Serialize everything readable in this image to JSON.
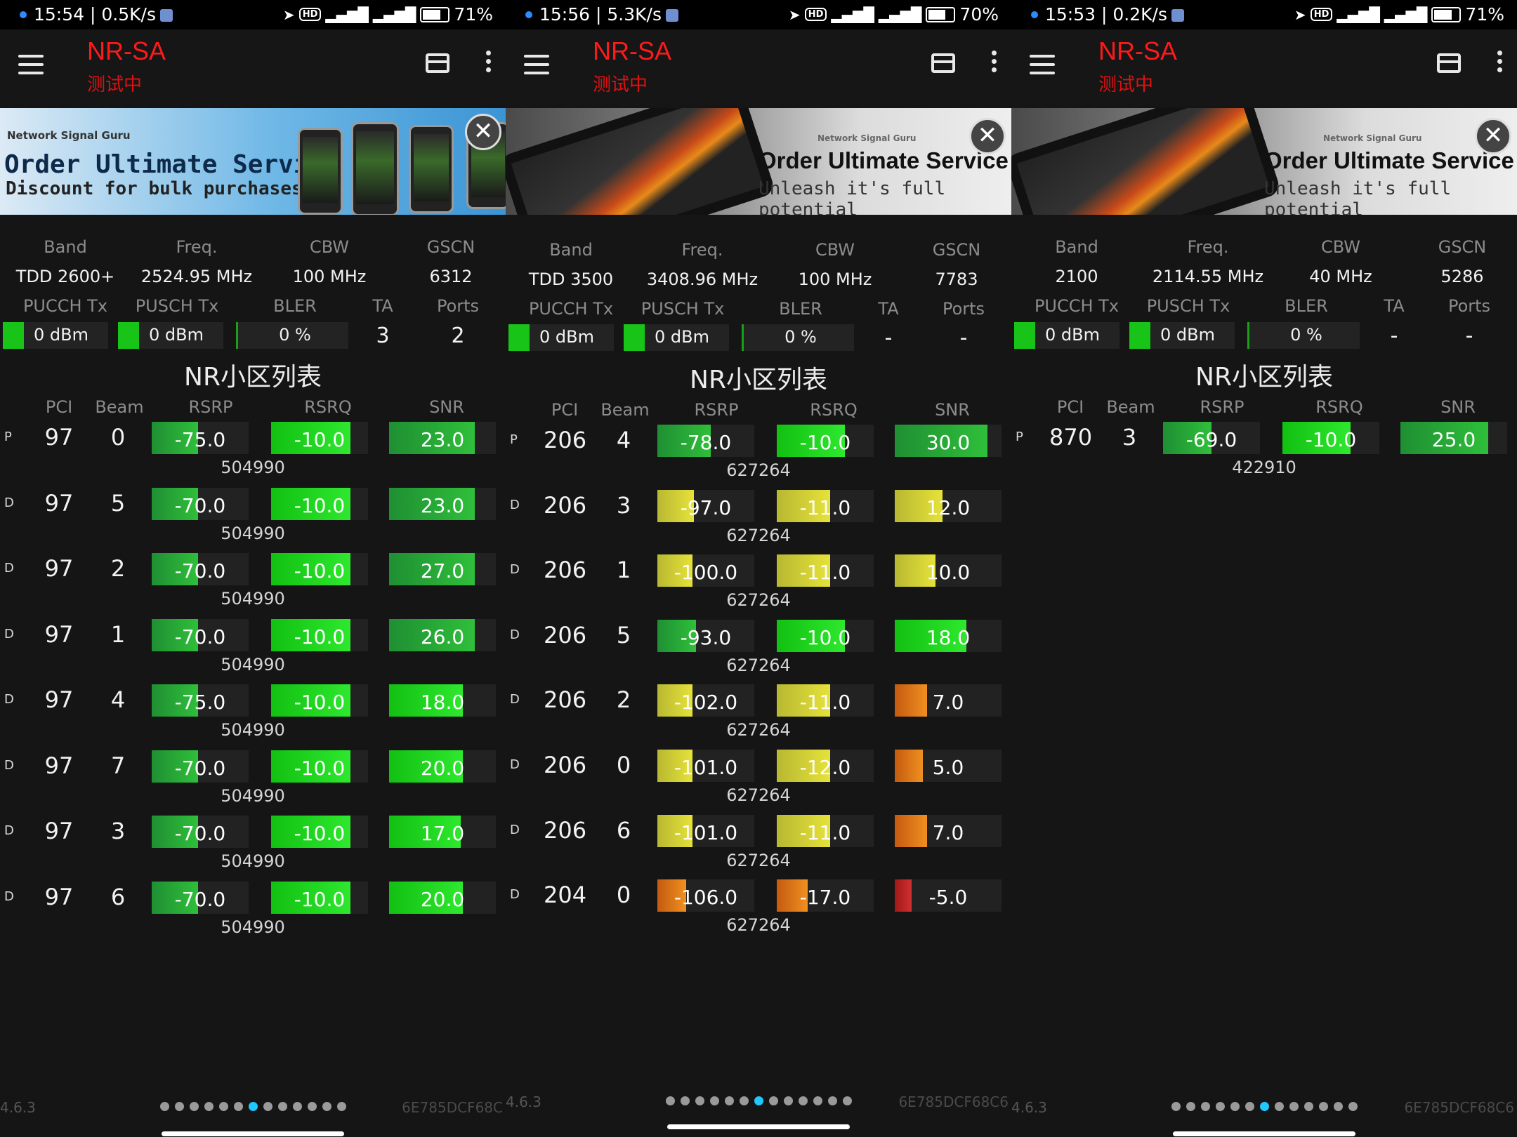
{
  "colors": {
    "accent": "#ff1a1a",
    "page_dot_active": "#1fc8ff",
    "good": "#18c418",
    "fair": "#c8c426",
    "weak": "#e07a1a",
    "bad": "#b02020"
  },
  "panels": [
    {
      "status": {
        "left": "15:54 | 0.5K/s",
        "battery": "71%",
        "battery_level": 0.71
      },
      "app": {
        "title": "NR-SA",
        "subtitle": "测试中"
      },
      "ad": {
        "brand": "Network Signal Guru",
        "headline": "Order Ultimate Service",
        "tagline": "Discount for bulk purchases",
        "close": "✕"
      },
      "info": {
        "labels1": [
          "Band",
          "Freq.",
          "CBW",
          "GSCN"
        ],
        "values1": [
          "TDD 2600+",
          "2524.95 MHz",
          "100 MHz",
          "6312"
        ],
        "labels2": [
          "PUCCH Tx",
          "PUSCH Tx",
          "BLER",
          "TA",
          "Ports"
        ],
        "values2": [
          "0 dBm",
          "0 dBm",
          "0 %",
          "3",
          "2"
        ]
      },
      "cell_list_title": "NR小区列表",
      "columns": [
        "PCI",
        "Beam",
        "RSRP",
        "RSRQ",
        "SNR"
      ],
      "cells": [
        {
          "type": "P",
          "pci": "97",
          "beam": "0",
          "rsrp": "-75.0",
          "rsrq": "-10.0",
          "snr": "23.0",
          "arfcn": "504990",
          "rsrp_level": 0.48,
          "rsrq_level": 0.82,
          "snr_level": 0.8,
          "rsrp_grade": "good",
          "rsrq_grade": "good",
          "snr_grade": "good"
        },
        {
          "type": "D",
          "pci": "97",
          "beam": "5",
          "rsrp": "-70.0",
          "rsrq": "-10.0",
          "snr": "23.0",
          "arfcn": "504990",
          "rsrp_level": 0.48,
          "rsrq_level": 0.82,
          "snr_level": 0.8,
          "rsrp_grade": "good",
          "rsrq_grade": "good",
          "snr_grade": "good"
        },
        {
          "type": "D",
          "pci": "97",
          "beam": "2",
          "rsrp": "-70.0",
          "rsrq": "-10.0",
          "snr": "27.0",
          "arfcn": "504990",
          "rsrp_level": 0.48,
          "rsrq_level": 0.82,
          "snr_level": 0.8,
          "rsrp_grade": "good",
          "rsrq_grade": "good",
          "snr_grade": "good"
        },
        {
          "type": "D",
          "pci": "97",
          "beam": "1",
          "rsrp": "-70.0",
          "rsrq": "-10.0",
          "snr": "26.0",
          "arfcn": "504990",
          "rsrp_level": 0.48,
          "rsrq_level": 0.82,
          "snr_level": 0.8,
          "rsrp_grade": "good",
          "rsrq_grade": "good",
          "snr_grade": "good"
        },
        {
          "type": "D",
          "pci": "97",
          "beam": "4",
          "rsrp": "-75.0",
          "rsrq": "-10.0",
          "snr": "18.0",
          "arfcn": "504990",
          "rsrp_level": 0.48,
          "rsrq_level": 0.82,
          "snr_level": 0.69,
          "rsrp_grade": "good",
          "rsrq_grade": "good",
          "snr_grade": "good"
        },
        {
          "type": "D",
          "pci": "97",
          "beam": "7",
          "rsrp": "-70.0",
          "rsrq": "-10.0",
          "snr": "20.0",
          "arfcn": "504990",
          "rsrp_level": 0.48,
          "rsrq_level": 0.82,
          "snr_level": 0.69,
          "rsrp_grade": "good",
          "rsrq_grade": "good",
          "snr_grade": "good"
        },
        {
          "type": "D",
          "pci": "97",
          "beam": "3",
          "rsrp": "-70.0",
          "rsrq": "-10.0",
          "snr": "17.0",
          "arfcn": "504990",
          "rsrp_level": 0.48,
          "rsrq_level": 0.82,
          "snr_level": 0.67,
          "rsrp_grade": "good",
          "rsrq_grade": "good",
          "snr_grade": "good"
        },
        {
          "type": "D",
          "pci": "97",
          "beam": "6",
          "rsrp": "-70.0",
          "rsrq": "-10.0",
          "snr": "20.0",
          "arfcn": "504990",
          "rsrp_level": 0.48,
          "rsrq_level": 0.82,
          "snr_level": 0.69,
          "rsrp_grade": "good",
          "rsrq_grade": "good",
          "snr_grade": "good"
        }
      ],
      "footer": {
        "version": "4.6.3",
        "device_id": "6E785DCF68C",
        "page_count": 13,
        "active_page": 6
      }
    },
    {
      "status": {
        "left": "15:56 | 5.3K/s",
        "battery": "70%",
        "battery_level": 0.7
      },
      "app": {
        "title": "NR-SA",
        "subtitle": "测试中"
      },
      "ad": {
        "brand": "Network Signal Guru",
        "headline": "Order Ultimate Service",
        "tagline": "Unleash it's full potential",
        "close": "✕"
      },
      "info": {
        "labels1": [
          "Band",
          "Freq.",
          "CBW",
          "GSCN"
        ],
        "values1": [
          "TDD 3500",
          "3408.96 MHz",
          "100 MHz",
          "7783"
        ],
        "labels2": [
          "PUCCH Tx",
          "PUSCH Tx",
          "BLER",
          "TA",
          "Ports"
        ],
        "values2": [
          "0 dBm",
          "0 dBm",
          "0 %",
          "-",
          "-"
        ]
      },
      "cell_list_title": "NR小区列表",
      "columns": [
        "PCI",
        "Beam",
        "RSRP",
        "RSRQ",
        "SNR"
      ],
      "cells": [
        {
          "type": "P",
          "pci": "206",
          "beam": "4",
          "rsrp": "-78.0",
          "rsrq": "-10.0",
          "snr": "30.0",
          "arfcn": "627264",
          "rsrp_level": 0.55,
          "rsrq_level": 0.7,
          "snr_level": 0.87,
          "rsrp_grade": "good",
          "rsrq_grade": "good",
          "snr_grade": "good"
        },
        {
          "type": "D",
          "pci": "206",
          "beam": "3",
          "rsrp": "-97.0",
          "rsrq": "-11.0",
          "snr": "12.0",
          "arfcn": "627264",
          "rsrp_level": 0.38,
          "rsrq_level": 0.55,
          "snr_level": 0.45,
          "rsrp_grade": "fair",
          "rsrq_grade": "fair",
          "snr_grade": "fair"
        },
        {
          "type": "D",
          "pci": "206",
          "beam": "1",
          "rsrp": "-100.0",
          "rsrq": "-11.0",
          "snr": "10.0",
          "arfcn": "627264",
          "rsrp_level": 0.36,
          "rsrq_level": 0.55,
          "snr_level": 0.38,
          "rsrp_grade": "fair",
          "rsrq_grade": "fair",
          "snr_grade": "fair"
        },
        {
          "type": "D",
          "pci": "206",
          "beam": "5",
          "rsrp": "-93.0",
          "rsrq": "-10.0",
          "snr": "18.0",
          "arfcn": "627264",
          "rsrp_level": 0.4,
          "rsrq_level": 0.7,
          "snr_level": 0.67,
          "rsrp_grade": "good",
          "rsrq_grade": "good",
          "snr_grade": "good"
        },
        {
          "type": "D",
          "pci": "206",
          "beam": "2",
          "rsrp": "-102.0",
          "rsrq": "-11.0",
          "snr": "7.0",
          "arfcn": "627264",
          "rsrp_level": 0.36,
          "rsrq_level": 0.55,
          "snr_level": 0.3,
          "rsrp_grade": "fair",
          "rsrq_grade": "fair",
          "snr_grade": "weak"
        },
        {
          "type": "D",
          "pci": "206",
          "beam": "0",
          "rsrp": "-101.0",
          "rsrq": "-12.0",
          "snr": "5.0",
          "arfcn": "627264",
          "rsrp_level": 0.36,
          "rsrq_level": 0.55,
          "snr_level": 0.26,
          "rsrp_grade": "fair",
          "rsrq_grade": "fair",
          "snr_grade": "weak"
        },
        {
          "type": "D",
          "pci": "206",
          "beam": "6",
          "rsrp": "-101.0",
          "rsrq": "-11.0",
          "snr": "7.0",
          "arfcn": "627264",
          "rsrp_level": 0.36,
          "rsrq_level": 0.55,
          "snr_level": 0.3,
          "rsrp_grade": "fair",
          "rsrq_grade": "fair",
          "snr_grade": "weak"
        },
        {
          "type": "D",
          "pci": "204",
          "beam": "0",
          "rsrp": "-106.0",
          "rsrq": "-17.0",
          "snr": "-5.0",
          "arfcn": "627264",
          "rsrp_level": 0.3,
          "rsrq_level": 0.32,
          "snr_level": 0.16,
          "rsrp_grade": "weak",
          "rsrq_grade": "weak",
          "snr_grade": "bad"
        }
      ],
      "footer": {
        "version": "4.6.3",
        "device_id": "6E785DCF68C6",
        "page_count": 13,
        "active_page": 6
      }
    },
    {
      "status": {
        "left": "15:53 | 0.2K/s",
        "battery": "71%",
        "battery_level": 0.71
      },
      "app": {
        "title": "NR-SA",
        "subtitle": "测试中"
      },
      "ad": {
        "brand": "Network Signal Guru",
        "headline": "Order Ultimate Service",
        "tagline": "Unleash it's full potential",
        "close": "✕"
      },
      "info": {
        "labels1": [
          "Band",
          "Freq.",
          "CBW",
          "GSCN"
        ],
        "values1": [
          "2100",
          "2114.55 MHz",
          "40 MHz",
          "5286"
        ],
        "labels2": [
          "PUCCH Tx",
          "PUSCH Tx",
          "BLER",
          "TA",
          "Ports"
        ],
        "values2": [
          "0 dBm",
          "0 dBm",
          "0 %",
          "-",
          "-"
        ]
      },
      "cell_list_title": "NR小区列表",
      "columns": [
        "PCI",
        "Beam",
        "RSRP",
        "RSRQ",
        "SNR"
      ],
      "cells": [
        {
          "type": "P",
          "pci": "870",
          "beam": "3",
          "rsrp": "-69.0",
          "rsrq": "-10.0",
          "snr": "25.0",
          "arfcn": "422910",
          "rsrp_level": 0.5,
          "rsrq_level": 0.7,
          "snr_level": 0.82,
          "rsrp_grade": "good",
          "rsrq_grade": "good",
          "snr_grade": "good"
        }
      ],
      "footer": {
        "version": "4.6.3",
        "device_id": "6E785DCF68C6",
        "page_count": 13,
        "active_page": 6
      }
    }
  ]
}
